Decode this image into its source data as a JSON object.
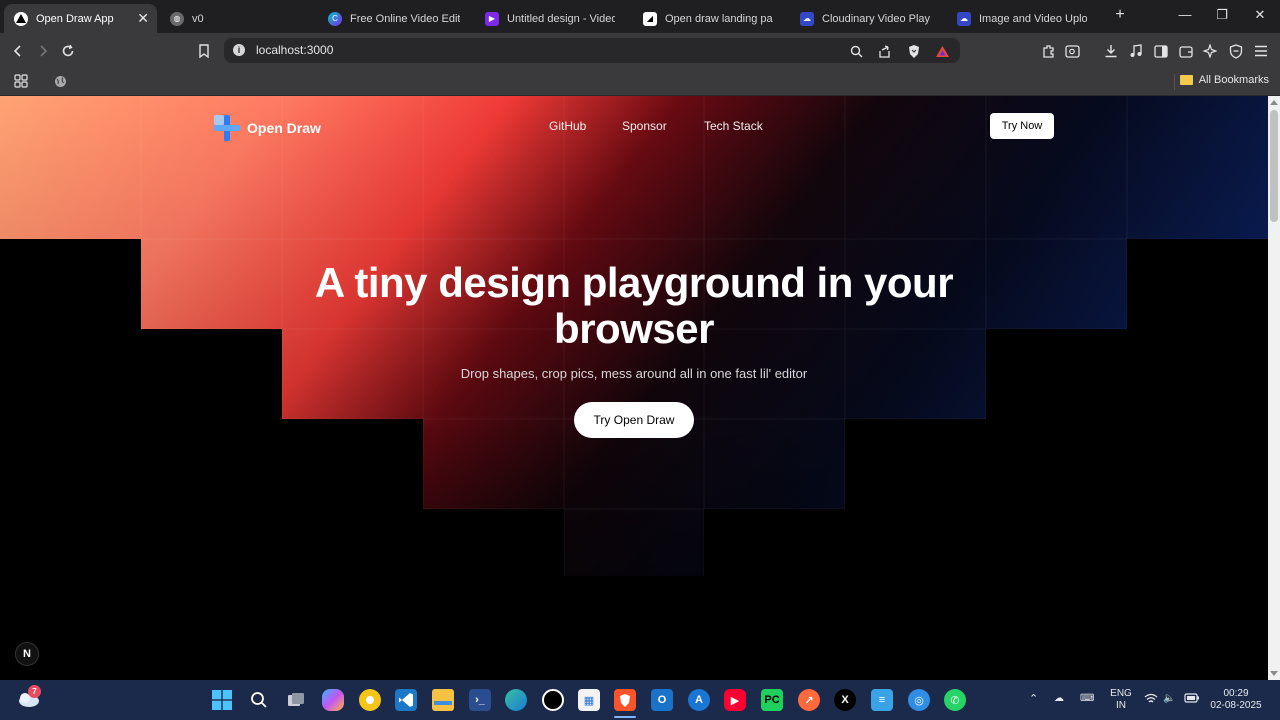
{
  "browser": {
    "tabs": [
      {
        "label": "Open Draw App",
        "active": true,
        "icon": "triangle-icon"
      },
      {
        "label": "v0",
        "icon": "globe-icon"
      },
      {
        "label": "Free Online Video Editor &",
        "icon": "canva-icon"
      },
      {
        "label": "Untitled design - Video",
        "icon": "canva-video-icon"
      },
      {
        "label": "Open draw landing page",
        "icon": "vercel-icon"
      },
      {
        "label": "Cloudinary Video Player E",
        "icon": "cloudinary-icon"
      },
      {
        "label": "Image and Video Upload,",
        "icon": "cloudinary-icon"
      }
    ],
    "url": "localhost:3000",
    "bookmarks_label": "All Bookmarks"
  },
  "page": {
    "brand": "Open Draw",
    "nav_links": [
      "GitHub",
      "Sponsor",
      "Tech Stack"
    ],
    "try_now": "Try Now",
    "headline": "A tiny design playground in your browser",
    "subheadline": "Drop shapes, crop pics, mess around all in one fast lil' editor",
    "cta": "Try Open Draw",
    "next_badge": "N"
  },
  "taskbar": {
    "notification_count": "7",
    "language_top": "ENG",
    "language_bottom": "IN",
    "time": "00:29",
    "date": "02-08-2025"
  },
  "colors": {
    "hero_peach": "#ffa070",
    "hero_red": "#e0282a",
    "hero_navy": "#0a1a44",
    "taskbar": "#1b2a4a"
  }
}
